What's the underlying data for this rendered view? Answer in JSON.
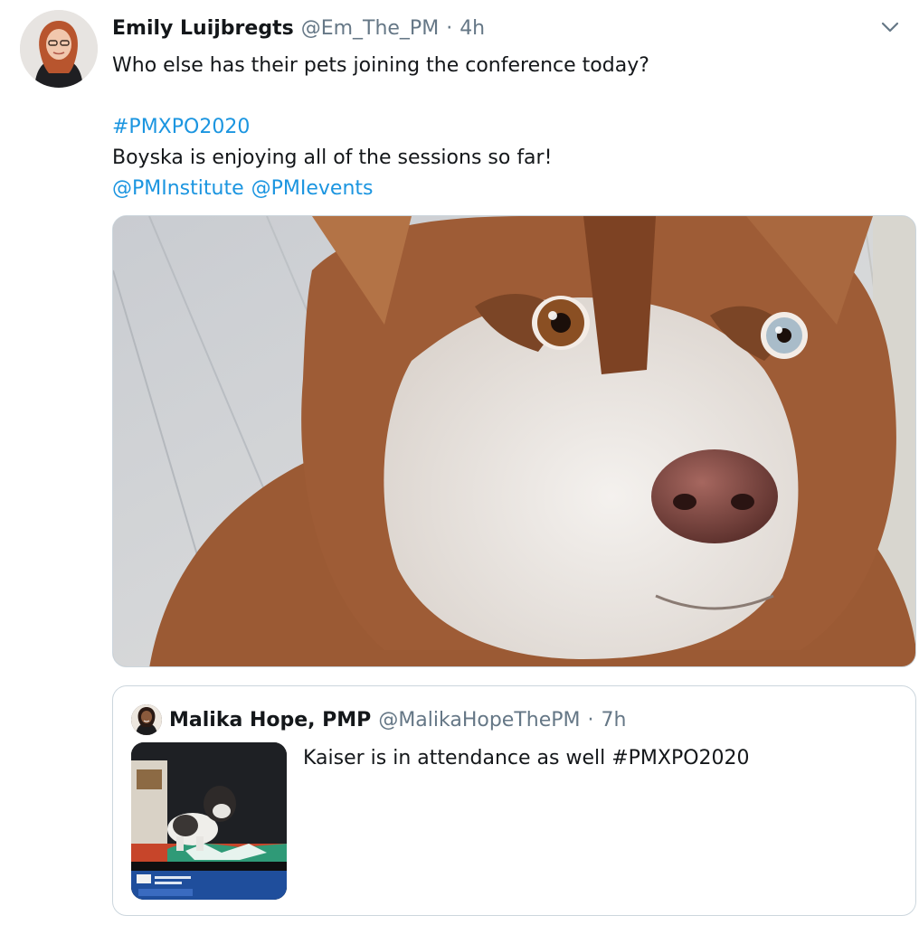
{
  "tweet": {
    "author_name": "Emily Luijbregts",
    "author_handle": "@Em_The_PM",
    "separator": "·",
    "time": "4h",
    "text_line1": "Who else has their pets joining the conference today?",
    "hashtag": "#PMXPO2020",
    "text_line3": "Boyska is enjoying all of the sessions so far!",
    "mention1": "@PMInstitute",
    "mention2": "@PMIevents",
    "caret_icon": "chevron-down-icon"
  },
  "quote": {
    "author_name": "Malika Hope, PMP",
    "author_handle": "@MalikaHopeThePM",
    "separator": "·",
    "time": "7h",
    "text": "Kaiser is in attendance as well #PMXPO2020"
  },
  "colors": {
    "link": "#1b95e0",
    "secondary_text": "#657786",
    "primary_text": "#14171a",
    "border": "#ccd6dd"
  }
}
